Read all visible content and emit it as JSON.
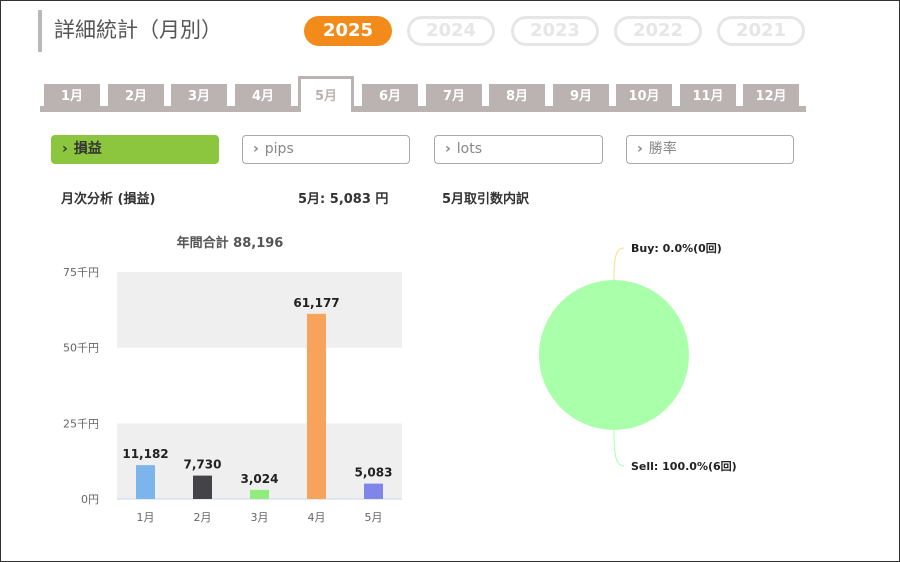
{
  "page_title": "詳細統計（月別）",
  "years": [
    {
      "label": "2025",
      "active": true
    },
    {
      "label": "2024",
      "active": false
    },
    {
      "label": "2023",
      "active": false
    },
    {
      "label": "2022",
      "active": false
    },
    {
      "label": "2021",
      "active": false
    }
  ],
  "months": [
    {
      "label": "1月",
      "active": false
    },
    {
      "label": "2月",
      "active": false
    },
    {
      "label": "3月",
      "active": false
    },
    {
      "label": "4月",
      "active": false
    },
    {
      "label": "5月",
      "active": true
    },
    {
      "label": "6月",
      "active": false
    },
    {
      "label": "7月",
      "active": false
    },
    {
      "label": "8月",
      "active": false
    },
    {
      "label": "9月",
      "active": false
    },
    {
      "label": "10月",
      "active": false
    },
    {
      "label": "11月",
      "active": false
    },
    {
      "label": "12月",
      "active": false
    }
  ],
  "metrics": [
    {
      "label": "損益",
      "active": true
    },
    {
      "label": "pips",
      "active": false
    },
    {
      "label": "lots",
      "active": false
    },
    {
      "label": "勝率",
      "active": false
    }
  ],
  "metric_chevron": "›",
  "summary": {
    "analysis_title": "月次分析 (損益)",
    "month_result": "5月:  5,083 円",
    "breakdown_title": "5月取引数内訳"
  },
  "colors": {
    "accent_orange": "#f28b1a",
    "active_green": "#8cc63f",
    "tab_gray": "#bbb2b2"
  },
  "chart_data": [
    {
      "type": "bar",
      "title": "年間合計 88,196",
      "categories": [
        "1月",
        "2月",
        "3月",
        "4月",
        "5月"
      ],
      "values": [
        11182,
        7730,
        3024,
        61177,
        5083
      ],
      "data_labels": [
        "11,182",
        "7,730",
        "3,024",
        "61,177",
        "5,083"
      ],
      "colors": [
        "#7cb5ec",
        "#434348",
        "#90ed7d",
        "#f7a35c",
        "#8085e9"
      ],
      "ylim": [
        0,
        75000
      ],
      "yticks": [
        0,
        25000,
        50000,
        75000
      ],
      "ytick_labels": [
        "0円",
        "25千円",
        "50千円",
        "75千円"
      ],
      "grid": "alternating bands"
    },
    {
      "type": "pie",
      "labels": [
        "Buy",
        "Sell"
      ],
      "values": [
        0.0,
        100.0
      ],
      "counts": [
        0,
        6
      ],
      "data_labels": [
        "Buy: 0.0%(0回)",
        "Sell: 100.0%(6回)"
      ],
      "colors": [
        "#7cb5ec",
        "#aaffaa"
      ]
    }
  ]
}
